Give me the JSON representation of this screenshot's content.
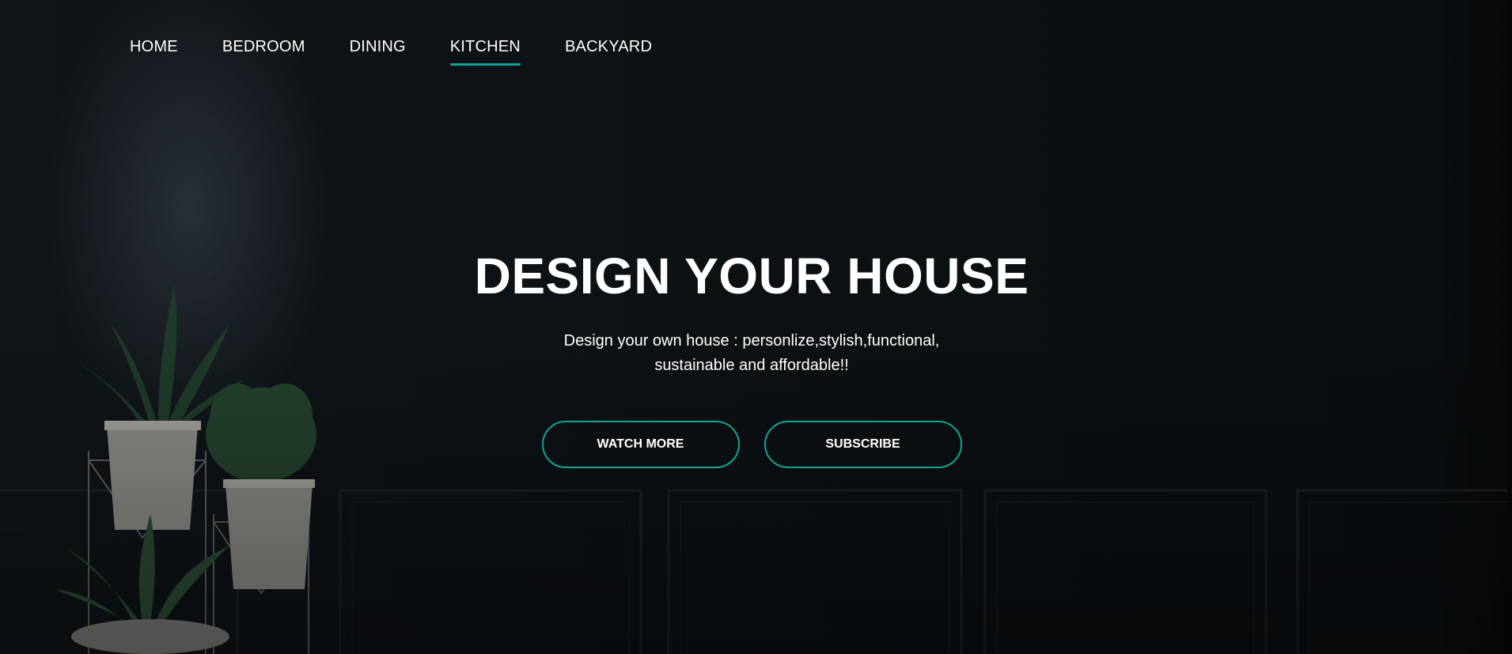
{
  "nav": {
    "items": [
      {
        "label": "HOME",
        "active": false
      },
      {
        "label": "BEDROOM",
        "active": false
      },
      {
        "label": "DINING",
        "active": false
      },
      {
        "label": "KITCHEN",
        "active": true
      },
      {
        "label": "BACKYARD",
        "active": false
      }
    ]
  },
  "hero": {
    "title": "DESIGN YOUR HOUSE",
    "subtitle": "Design your own house : personlize,stylish,functional, sustainable and affordable!!",
    "buttons": {
      "watch_more": "WATCH MORE",
      "subscribe": "SUBSCRIBE"
    }
  },
  "colors": {
    "accent": "#14a394",
    "background": "#0d1114",
    "text": "#ffffff"
  }
}
